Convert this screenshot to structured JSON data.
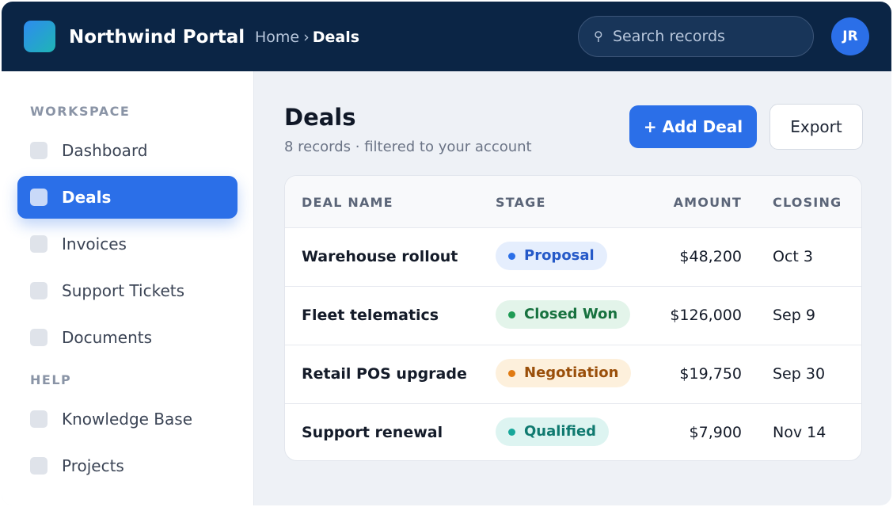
{
  "header": {
    "app_title": "Northwind Portal",
    "breadcrumb": {
      "root": "Home",
      "separator": "›",
      "current": "Deals"
    },
    "search": {
      "placeholder": "Search records",
      "icon": "search-icon"
    },
    "avatar_initials": "JR"
  },
  "sidebar": {
    "sections": [
      {
        "label": "WORKSPACE"
      },
      {
        "label": "HELP"
      }
    ],
    "items": [
      {
        "label": "Dashboard",
        "active": false
      },
      {
        "label": "Deals",
        "active": true
      },
      {
        "label": "Invoices",
        "active": false
      },
      {
        "label": "Support Tickets",
        "active": false
      },
      {
        "label": "Documents",
        "active": false
      },
      {
        "label": "Knowledge Base",
        "active": false
      },
      {
        "label": "Projects",
        "active": false
      }
    ]
  },
  "main": {
    "title": "Deals",
    "subtitle": "8 records · filtered to your account",
    "add_button": "+ Add Deal",
    "export_button": "Export",
    "table": {
      "columns": [
        "DEAL NAME",
        "STAGE",
        "AMOUNT",
        "CLOSING"
      ],
      "rows": [
        {
          "name": "Warehouse rollout",
          "stage": "Proposal",
          "amount": "$48,200",
          "closing": "Oct 3"
        },
        {
          "name": "Fleet telematics",
          "stage": "Closed Won",
          "amount": "$126,000",
          "closing": "Sep 9"
        },
        {
          "name": "Retail POS upgrade",
          "stage": "Negotiation",
          "amount": "$19,750",
          "closing": "Sep 30"
        },
        {
          "name": "Support renewal",
          "stage": "Qualified",
          "amount": "$7,900",
          "closing": "Nov 14"
        }
      ]
    }
  },
  "colors": {
    "header_bg": "#0b2545",
    "accent": "#2b6fe8",
    "proposal": "#2b6fe8",
    "closed_won": "#1e9c54",
    "negotiation": "#e07a12",
    "qualified": "#16a79a"
  }
}
